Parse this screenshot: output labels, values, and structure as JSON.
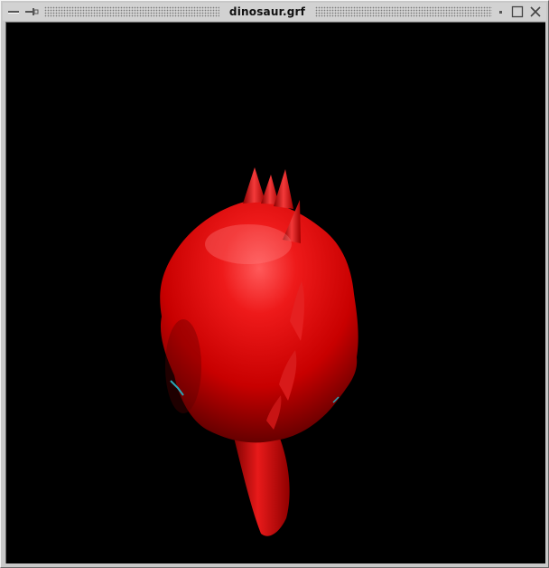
{
  "window": {
    "title": "dinosaur.grf"
  },
  "titlebar_buttons": {
    "menu_icon": "minus-icon",
    "pin_icon": "pin-icon",
    "shade_icon": "dot-icon",
    "maximize_icon": "square-icon",
    "close_icon": "close-icon"
  },
  "viewport": {
    "background": "#000000",
    "model_color": "#e00000",
    "accent_color": "#2aa8b8"
  }
}
